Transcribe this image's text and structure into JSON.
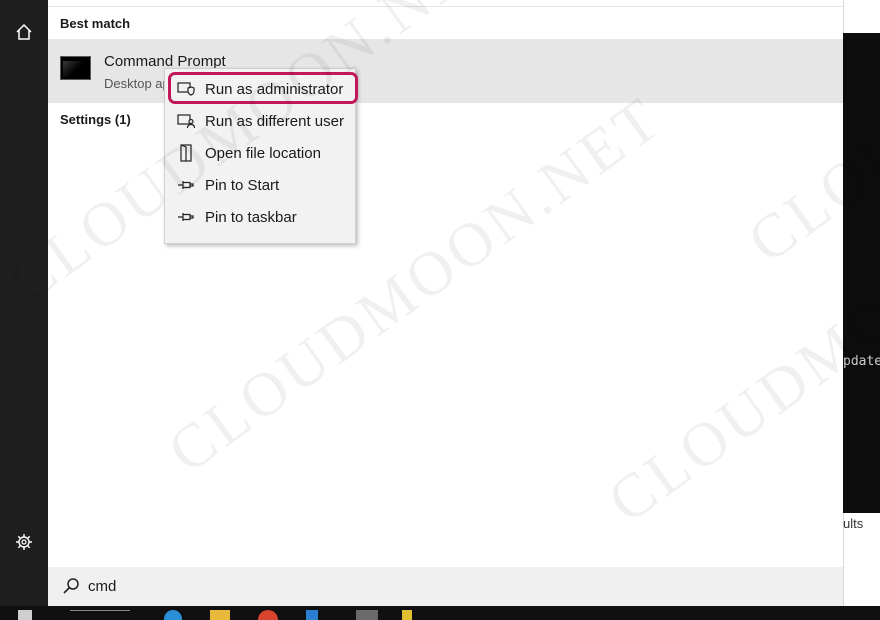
{
  "start_panel": {
    "best_match_label": "Best match",
    "result": {
      "title": "Command Prompt",
      "subtitle": "Desktop app"
    },
    "settings_label": "Settings (1)"
  },
  "context_menu": {
    "items": [
      {
        "label": "Run as administrator",
        "icon": "shield-window-icon",
        "highlighted": true
      },
      {
        "label": "Run as different user",
        "icon": "user-window-icon"
      },
      {
        "label": "Open file location",
        "icon": "folder-location-icon"
      },
      {
        "label": "Pin to Start",
        "icon": "pin-icon"
      },
      {
        "label": "Pin to taskbar",
        "icon": "pin-icon"
      }
    ],
    "highlight_color": "#c2185b"
  },
  "search": {
    "value": "cmd",
    "icon": "search-icon"
  },
  "rail": {
    "icons": [
      "home-icon",
      "gear-icon"
    ]
  },
  "background_window": {
    "dark_text": "pdate",
    "lower_text": "ults"
  },
  "watermark": {
    "text": "CLOUDMOON.NET"
  },
  "colors": {
    "rail": "#1f1f1f",
    "selected_row": "#e6e6e6",
    "menu": "#f2f2f2"
  }
}
